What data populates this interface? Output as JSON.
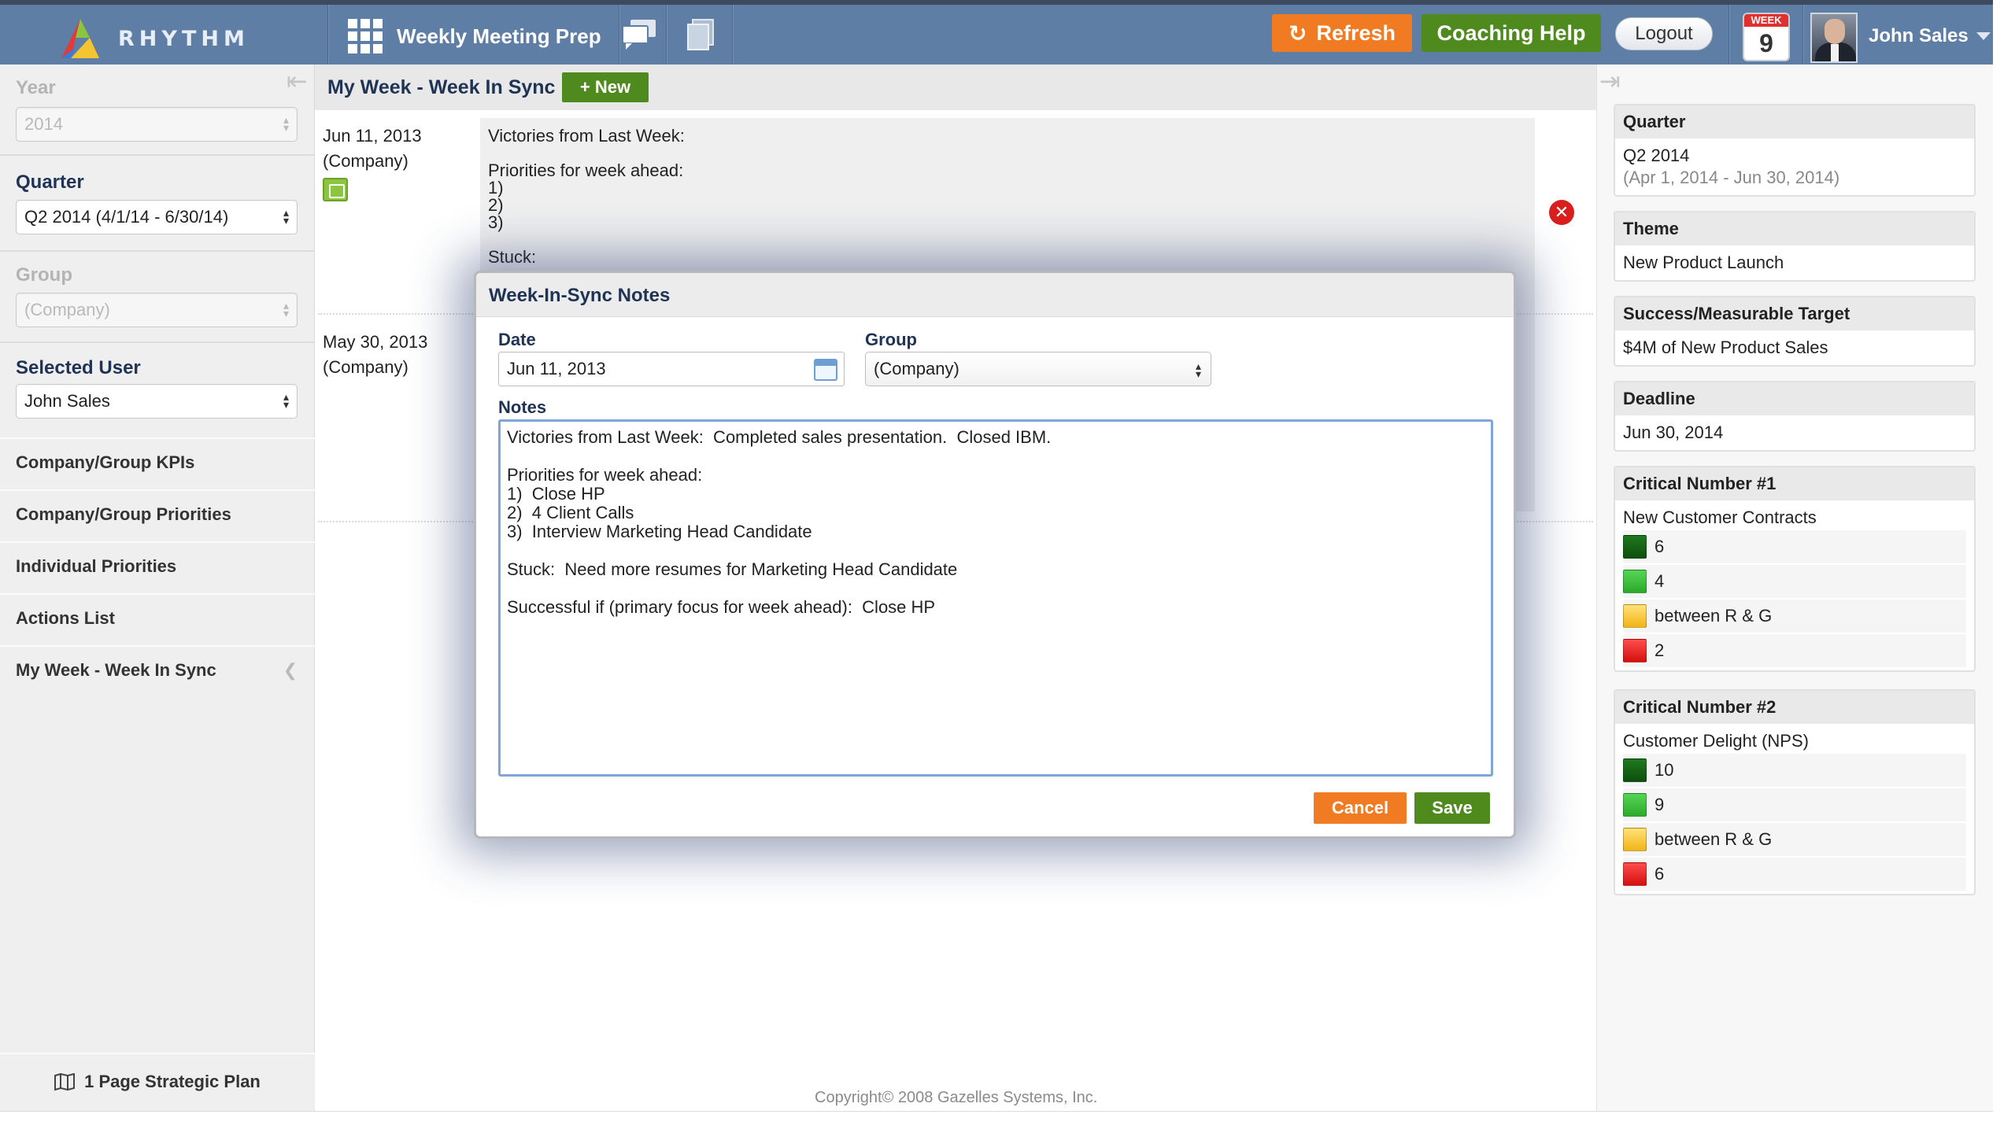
{
  "app": {
    "logo_text": "RHYTHM",
    "title": "Weekly Meeting Prep"
  },
  "topbar": {
    "refresh_label": "Refresh",
    "coaching_label": "Coaching Help",
    "logout_label": "Logout",
    "week_label": "WEEK",
    "week_number": "9",
    "user_name": "John Sales"
  },
  "sidebar": {
    "year_label": "Year",
    "year_value": "2014",
    "quarter_label": "Quarter",
    "quarter_value": "Q2 2014 (4/1/14 - 6/30/14)",
    "group_label": "Group",
    "group_value": "(Company)",
    "selected_user_label": "Selected User",
    "selected_user_value": "John Sales",
    "items": [
      {
        "label": "Company/Group KPIs"
      },
      {
        "label": "Company/Group Priorities"
      },
      {
        "label": "Individual Priorities"
      },
      {
        "label": "Actions List"
      },
      {
        "label": "My Week - Week In Sync"
      }
    ],
    "bottom_link": "1 Page Strategic Plan"
  },
  "main": {
    "title": "My Week - Week In Sync",
    "new_button": "+ New",
    "entries": [
      {
        "date": "Jun 11, 2013",
        "group": "(Company)",
        "lines": [
          "Victories from Last Week:",
          "Priorities for week ahead:",
          "1)",
          "2)",
          "3)",
          "Stuck:"
        ]
      },
      {
        "date": "May 30, 2013",
        "group": "(Company)"
      }
    ],
    "copyright": "Copyright© 2008 Gazelles Systems, Inc."
  },
  "modal": {
    "title": "Week-In-Sync Notes",
    "date_label": "Date",
    "date_value": "Jun 11, 2013",
    "group_label": "Group",
    "group_value": "(Company)",
    "notes_label": "Notes",
    "notes_value": "Victories from Last Week:  Completed sales presentation.  Closed IBM.\n\nPriorities for week ahead:\n1)  Close HP\n2)  4 Client Calls\n3)  Interview Marketing Head Candidate\n\nStuck:  Need more resumes for Marketing Head Candidate\n\nSuccessful if (primary focus for week ahead):  Close HP",
    "cancel_label": "Cancel",
    "save_label": "Save"
  },
  "right_panel": {
    "quarter": {
      "title": "Quarter",
      "value": "Q2 2014",
      "range": "(Apr 1, 2014 - Jun 30, 2014)"
    },
    "theme": {
      "title": "Theme",
      "value": "New Product Launch"
    },
    "target": {
      "title": "Success/Measurable Target",
      "value": "$4M of New Product Sales"
    },
    "deadline": {
      "title": "Deadline",
      "value": "Jun 30, 2014"
    },
    "cn1": {
      "title": "Critical Number #1",
      "name": "New Customer Contracts",
      "levels": [
        "6",
        "4",
        "between R & G",
        "2"
      ]
    },
    "cn2": {
      "title": "Critical Number #2",
      "name": "Customer Delight (NPS)",
      "levels": [
        "10",
        "9",
        "between R & G",
        "6"
      ]
    }
  },
  "colors": {
    "topbar": "#5f7ea6",
    "orange": "#f07b23",
    "green": "#4f8a1f",
    "navy_text": "#1f3355",
    "status_dark_green": "#1f7a1f",
    "status_green": "#3bbb3b",
    "status_yellow": "#f5c531",
    "status_red": "#e62020"
  }
}
